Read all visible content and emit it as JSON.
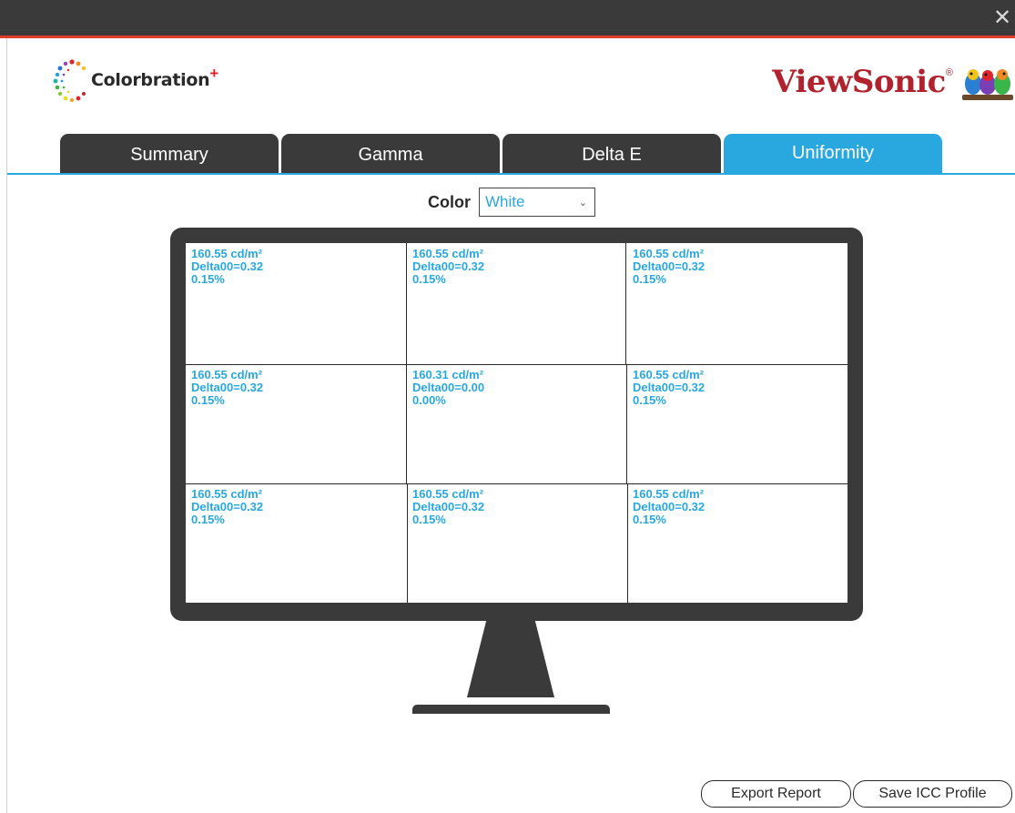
{
  "window": {
    "close_glyph": "✕"
  },
  "brand_left": {
    "name": "Colorbration",
    "plus": "+"
  },
  "brand_right": {
    "name": "ViewSonic",
    "reg": "®"
  },
  "tabs": [
    {
      "label": "Summary",
      "active": false
    },
    {
      "label": "Gamma",
      "active": false
    },
    {
      "label": "Delta E",
      "active": false
    },
    {
      "label": "Uniformity",
      "active": true
    }
  ],
  "color_select": {
    "label": "Color",
    "value": "White"
  },
  "uniformity": {
    "cells": [
      {
        "luminance": "160.55 cd/m²",
        "delta": "Delta00=0.32",
        "percent": "0.15%"
      },
      {
        "luminance": "160.55 cd/m²",
        "delta": "Delta00=0.32",
        "percent": "0.15%"
      },
      {
        "luminance": "160.55 cd/m²",
        "delta": "Delta00=0.32",
        "percent": "0.15%"
      },
      {
        "luminance": "160.55 cd/m²",
        "delta": "Delta00=0.32",
        "percent": "0.15%"
      },
      {
        "luminance": "160.31 cd/m²",
        "delta": "Delta00=0.00",
        "percent": "0.00%"
      },
      {
        "luminance": "160.55 cd/m²",
        "delta": "Delta00=0.32",
        "percent": "0.15%"
      },
      {
        "luminance": "160.55 cd/m²",
        "delta": "Delta00=0.32",
        "percent": "0.15%"
      },
      {
        "luminance": "160.55 cd/m²",
        "delta": "Delta00=0.32",
        "percent": "0.15%"
      },
      {
        "luminance": "160.55 cd/m²",
        "delta": "Delta00=0.32",
        "percent": "0.15%"
      }
    ]
  },
  "buttons": {
    "export_report": "Export Report",
    "save_icc_profile": "Save ICC Profile"
  },
  "colors": {
    "accent_blue": "#29a8e0",
    "dark_gray": "#3a3a3a",
    "brand_red": "#b0232e",
    "titlebar_red": "#e23b2e"
  }
}
